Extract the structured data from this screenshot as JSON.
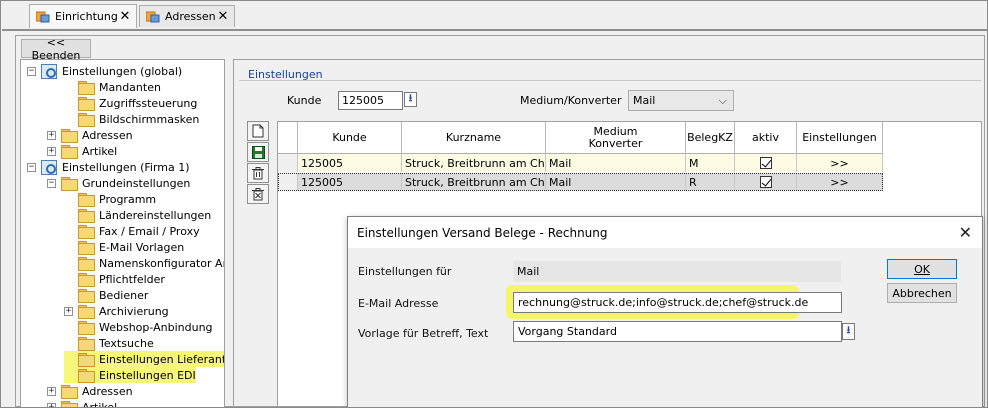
{
  "tabs": [
    {
      "label": "Einrichtung",
      "close": "✕",
      "active": true
    },
    {
      "label": "Adressen",
      "close": "✕",
      "active": false
    }
  ],
  "toolbar": {
    "beenden_label": "<< Beenden"
  },
  "tree": {
    "items": [
      {
        "label": "Einstellungen (global)",
        "expander": "−",
        "icon": "settings-gear-icon"
      },
      {
        "label": "Mandanten"
      },
      {
        "label": "Zugriffssteuerung"
      },
      {
        "label": "Bildschirmmasken"
      },
      {
        "label": "Adressen",
        "expander": "+"
      },
      {
        "label": "Artikel",
        "expander": "+"
      },
      {
        "label": "Einstellungen (Firma 1)",
        "expander": "−",
        "icon": "settings-gear-icon"
      },
      {
        "label": "Grundeinstellungen",
        "expander": "−"
      },
      {
        "label": "Programm"
      },
      {
        "label": "Ländereinstellungen"
      },
      {
        "label": "Fax / Email / Proxy"
      },
      {
        "label": "E-Mail Vorlagen"
      },
      {
        "label": "Namenskonfigurator Anha"
      },
      {
        "label": "Pflichtfelder"
      },
      {
        "label": "Bediener"
      },
      {
        "label": "Archivierung",
        "expander": "+"
      },
      {
        "label": "Webshop-Anbindung"
      },
      {
        "label": "Textsuche"
      },
      {
        "label": "Einstellungen Lieferanten"
      },
      {
        "label": "Einstellungen EDI"
      },
      {
        "label": "Adressen",
        "expander": "+"
      },
      {
        "label": "Artikel",
        "expander": "+"
      }
    ]
  },
  "settings": {
    "group_title": "Einstellungen",
    "kunde_label": "Kunde",
    "kunde_value": "125005",
    "medium_label": "Medium/Konverter",
    "medium_value": "Mail"
  },
  "grid": {
    "headers": [
      "Kunde",
      "Kurzname",
      "Medium\nKonverter",
      "BelegKZ",
      "aktiv",
      "Einstellungen"
    ],
    "rows": [
      {
        "kunde": "125005",
        "kurzname": "Struck, Breitbrunn am Chiem",
        "medium": "Mail",
        "belegkz": "M",
        "aktiv": true,
        "einstellungen": ">>"
      },
      {
        "kunde": "125005",
        "kurzname": "Struck, Breitbrunn am Chiem",
        "medium": "Mail",
        "belegkz": "R",
        "aktiv": true,
        "einstellungen": ">>"
      }
    ]
  },
  "dialog": {
    "title": "Einstellungen Versand Belege - Rechnung",
    "close": "✕",
    "einstellungen_fuer_label": "Einstellungen für",
    "einstellungen_fuer_value": "Mail",
    "email_label": "E-Mail Adresse",
    "email_value": "rechnung@struck.de;info@struck.de;chef@struck.de",
    "vorlage_label": "Vorlage für Betreff, Text",
    "vorlage_value": "Vorgang Standard",
    "ok_label": "OK",
    "cancel_label": "Abbrechen"
  },
  "colors": {
    "highlight": "#f5f56a",
    "link_blue": "#1a3e9a",
    "selected_row": "#fdfbe3"
  }
}
